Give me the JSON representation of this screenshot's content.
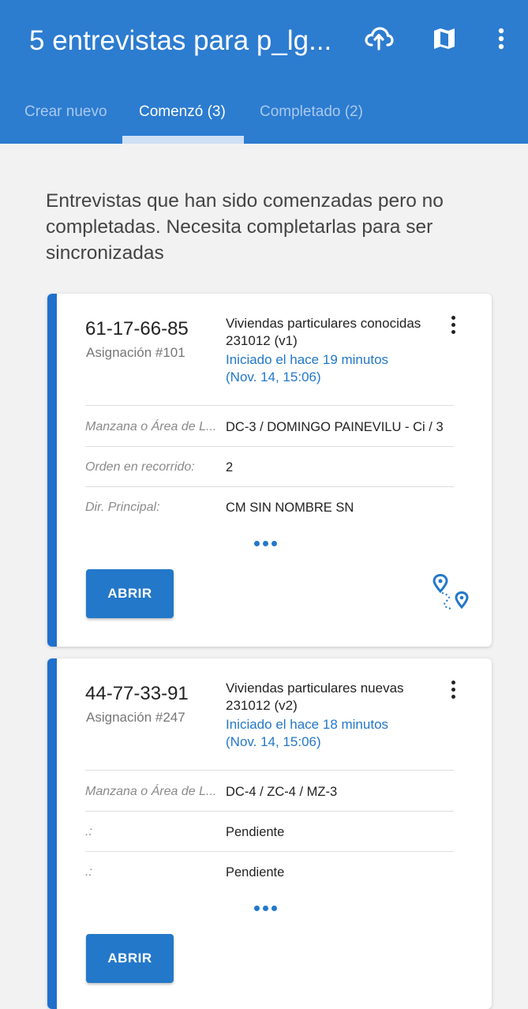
{
  "appbar": {
    "title": "5 entrevistas para p_lg...",
    "icons": [
      "cloud-sync-icon",
      "map-icon",
      "more-vert-icon"
    ],
    "color": "#2c7cd0"
  },
  "tabs": [
    {
      "label": "Crear nuevo",
      "active": false
    },
    {
      "label": "Comenzó (3)",
      "active": true
    },
    {
      "label": "Completado (2)",
      "active": false
    }
  ],
  "intro": "Entrevistas que han sido comenzadas pero no completadas. Necesita completarlas para ser sincronizadas",
  "cards": [
    {
      "id": "61-17-66-85",
      "assignment": "Asignación #101",
      "questionnaire": "Viviendas particulares conocidas 231012 (v1)",
      "started": "Iniciado el hace 19 minutos (Nov. 14, 15:06)",
      "rows": [
        {
          "label": "Manzana o Área de L...",
          "value": "DC-3 / DOMINGO PAINEVILU - Ci / 3"
        },
        {
          "label": "Orden en recorrido:",
          "value": "2"
        },
        {
          "label": "Dir. Principal:",
          "value": "CM SIN NOMBRE SN"
        }
      ],
      "open_label": "ABRIR"
    },
    {
      "id": "44-77-33-91",
      "assignment": "Asignación #247",
      "questionnaire": "Viviendas particulares nuevas 231012 (v2)",
      "started": "Iniciado el hace 18 minutos (Nov. 14, 15:06)",
      "rows": [
        {
          "label": "Manzana o Área de L...",
          "value": "DC-4 / ZC-4 / MZ-3"
        },
        {
          "label": ".:",
          "value": "Pendiente"
        },
        {
          "label": ".:",
          "value": "Pendiente"
        }
      ],
      "open_label": "ABRIR"
    }
  ]
}
